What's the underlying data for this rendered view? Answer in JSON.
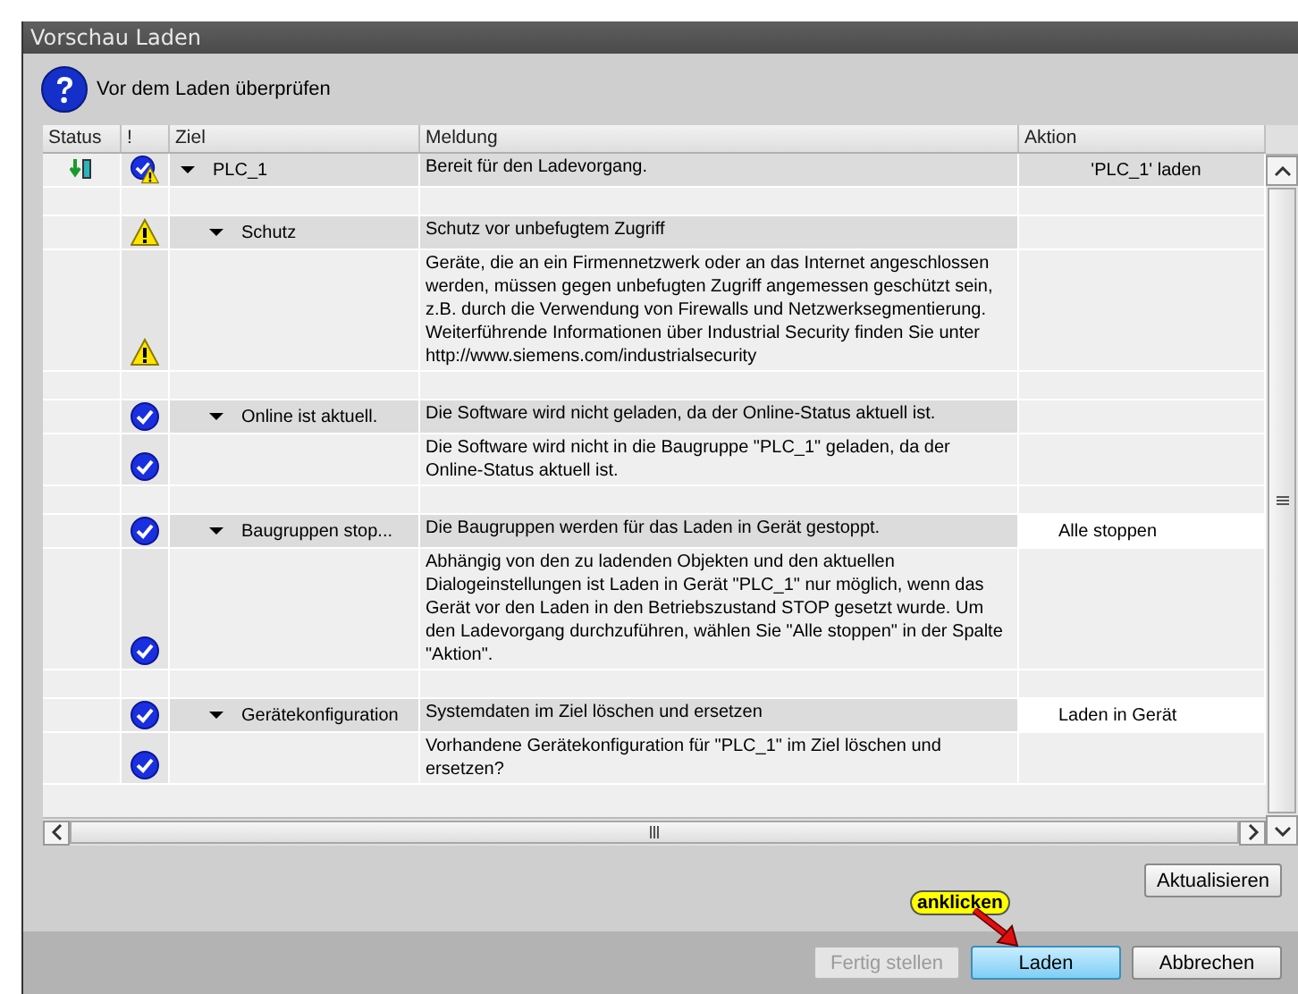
{
  "window": {
    "title": "Vorschau Laden"
  },
  "header": {
    "text": "Vor dem Laden überprüfen"
  },
  "table": {
    "columns": [
      "Status",
      "!",
      "Ziel",
      "Meldung",
      "Aktion"
    ],
    "root": {
      "status_icon": {
        "kind": "download"
      },
      "alert_icon": {
        "kind": "ok_warning"
      },
      "ziel": "PLC_1",
      "expanded": true,
      "meldung": "Bereit für den Ladevorgang.",
      "aktion": {
        "kind": "plain",
        "text": "'PLC_1' laden"
      },
      "children": [
        {
          "alert_icon": {
            "kind": "warning"
          },
          "ziel": "Schutz",
          "expanded": true,
          "meldung": "Schutz vor unbefugtem Zugriff",
          "detail": {
            "alert_icon": {
              "kind": "warning"
            },
            "text": "Geräte, die an ein Firmennetzwerk oder an das Internet angeschlossen werden, müssen gegen unbefugten Zugriff angemessen geschützt sein, z.B. durch die Verwendung von Firewalls und Netzwerksegmentierung. Weiterführende Informationen über Industrial Security finden Sie unter http://www.siemens.com/industrialsecurity"
          }
        },
        {
          "alert_icon": {
            "kind": "ok"
          },
          "ziel": "Online ist aktuell.",
          "expanded": true,
          "meldung": "Die Software wird nicht geladen, da der Online-Status aktuell ist.",
          "detail": {
            "alert_icon": {
              "kind": "ok"
            },
            "text": "Die Software wird nicht in die Baugruppe \"PLC_1\" geladen, da der Online-Status aktuell ist."
          }
        },
        {
          "alert_icon": {
            "kind": "ok"
          },
          "ziel": "Baugruppen stop...",
          "expanded": true,
          "meldung": "Die Baugruppen werden für das Laden in Gerät gestoppt.",
          "aktion": {
            "kind": "dropdown",
            "text": "Alle stoppen"
          },
          "detail": {
            "alert_icon": {
              "kind": "ok"
            },
            "text": "Abhängig von den zu ladenden Objekten und den aktuellen Dialogeinstellungen ist Laden in Gerät \"PLC_1\" nur möglich, wenn das Gerät vor den Laden in den Betriebszustand STOP gesetzt wurde. Um den Ladevorgang durchzuführen, wählen Sie \"Alle stoppen\" in der Spalte \"Aktion\"."
          }
        },
        {
          "alert_icon": {
            "kind": "ok"
          },
          "ziel": "Gerätekonfiguration",
          "expanded": true,
          "meldung": "Systemdaten im Ziel löschen und ersetzen",
          "aktion": {
            "kind": "dropdown",
            "text": "Laden in Gerät"
          },
          "detail": {
            "alert_icon": {
              "kind": "ok"
            },
            "text": "Vorhandene Gerätekonfiguration für \"PLC_1\" im Ziel löschen und ersetzen?"
          }
        }
      ]
    }
  },
  "refresh_button": {
    "label": "Aktualisieren"
  },
  "buttons": [
    {
      "label": "Fertig stellen",
      "disabled": true,
      "default": false
    },
    {
      "label": "Laden",
      "disabled": false,
      "default": true
    },
    {
      "label": "Abbrechen",
      "disabled": false,
      "default": false
    }
  ],
  "callout": {
    "text": "anklicken"
  }
}
